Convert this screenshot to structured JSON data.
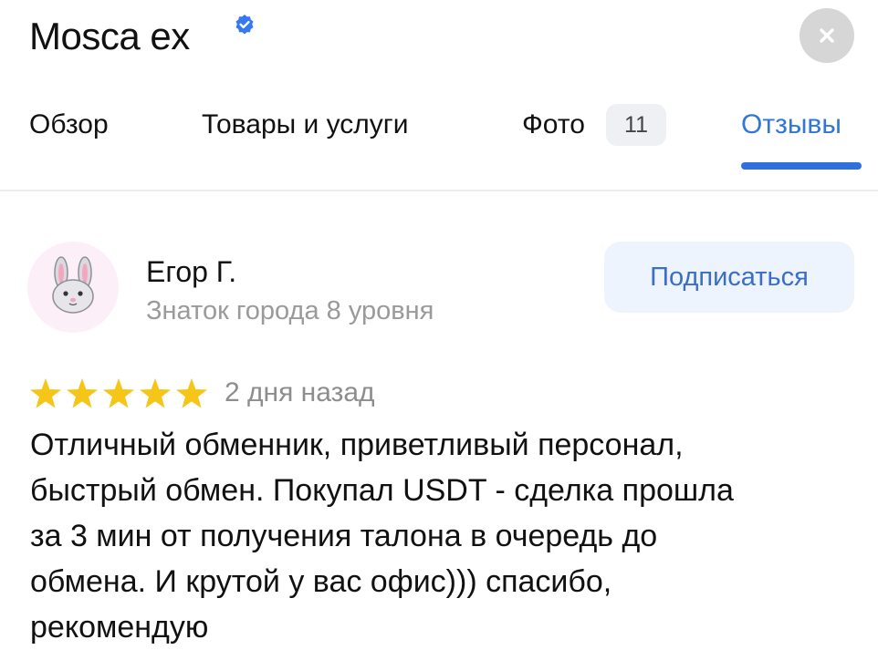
{
  "header": {
    "title": "Mosca ex",
    "verified_icon": "verified-checkmark-icon",
    "close_icon": "close-icon"
  },
  "tabs": [
    {
      "label": "Обзор",
      "active": false
    },
    {
      "label": "Товары и услуги",
      "active": false
    },
    {
      "label": "Фото",
      "badge": "11",
      "active": false
    },
    {
      "label": "Отзывы",
      "active": true
    }
  ],
  "review": {
    "author": {
      "name": "Егор Г.",
      "level": "Знаток города 8 уровня",
      "avatar_icon": "rabbit-avatar-icon"
    },
    "subscribe_label": "Подписаться",
    "rating": 5,
    "rating_max": 5,
    "date": "2 дня назад",
    "text": "Отличный обменник, приветливый персонал,\nбыстрый обмен. Покупал USDT - сделка прошла\nза 3 мин от получения талона в очередь до\nобмена. И крутой  у вас офис))) спасибо,\nрекомендую"
  },
  "colors": {
    "accent": "#2f70dc",
    "star": "#f5c518",
    "verified": "#3478f6",
    "muted_text": "#9a9a9a"
  }
}
